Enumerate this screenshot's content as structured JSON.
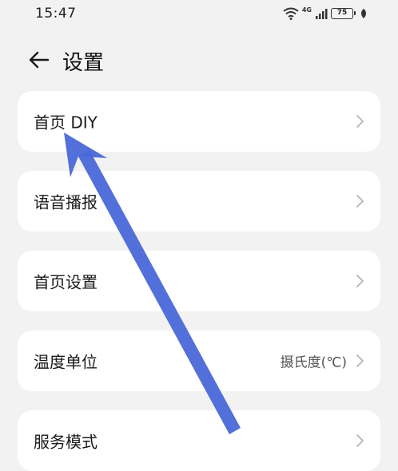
{
  "status_bar": {
    "time": "15:47",
    "network": "4G",
    "battery": "75"
  },
  "header": {
    "title": "设置"
  },
  "settings_items": [
    {
      "label": "首页 DIY",
      "value": ""
    },
    {
      "label": "语音播报",
      "value": ""
    },
    {
      "label": "首页设置",
      "value": ""
    },
    {
      "label": "温度单位",
      "value": "摄氏度(℃)"
    },
    {
      "label": "服务模式",
      "value": ""
    }
  ],
  "colors": {
    "background": "#f2f2f2",
    "card": "#ffffff",
    "annotation_arrow": "#4a68d8"
  }
}
